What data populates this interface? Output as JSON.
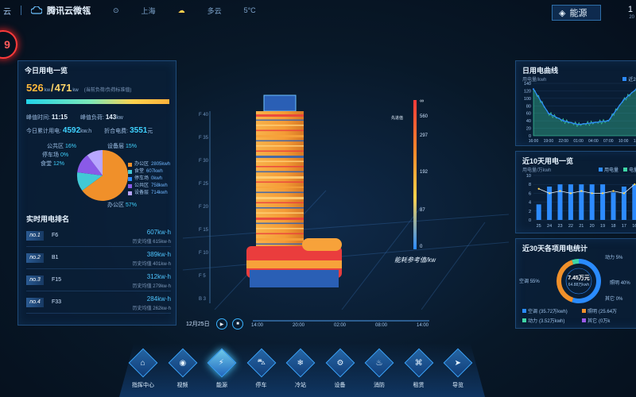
{
  "topbar": {
    "brand_prefix": "云",
    "brand_title": "腾讯云微瓴",
    "location": "上海",
    "weather": "多云",
    "temperature": "5°C",
    "section_label": "能源",
    "clock": "1",
    "clock_sub": "20"
  },
  "alert_badge": "9",
  "left_panel": {
    "title": "今日用电一览",
    "current_load": "526",
    "load_sep": "/",
    "rated_load": "471",
    "load_unit1": "kw",
    "load_unit2": "kw",
    "load_note": "(当前负荷/负荷标准值)",
    "peak_time_label": "峰值时间:",
    "peak_time": "11:15",
    "peak_load_label": "峰值负荷:",
    "peak_load": "143",
    "peak_load_unit": "kw",
    "today_total_label": "今日累计用电:",
    "today_total": "4592",
    "today_total_unit": "kw.h",
    "cost_label": "折合电费:",
    "cost": "3551",
    "cost_unit": "元",
    "pie_labels": [
      {
        "name": "公共区",
        "pct": "16%"
      },
      {
        "name": "停车场",
        "pct": "0%"
      },
      {
        "name": "食堂",
        "pct": "12%"
      },
      {
        "name": "设备层",
        "pct": "15%"
      },
      {
        "name": "办公区",
        "pct": "57%"
      }
    ],
    "legend": [
      {
        "name": "办公区",
        "value": "2805kwh",
        "color": "#f0902a"
      },
      {
        "name": "食堂",
        "value": "607kwh",
        "color": "#42c9d6"
      },
      {
        "name": "停车场",
        "value": "0kwh",
        "color": "#2d8bff"
      },
      {
        "name": "公共区",
        "value": "758kwh",
        "color": "#8a5ae8"
      },
      {
        "name": "设备层",
        "value": "714kwh",
        "color": "#b8a6ff"
      }
    ],
    "rank_title": "实时用电排名",
    "rank": [
      {
        "no": "no.1",
        "name": "F6",
        "value": "607kw·h",
        "hist": "历史均值 615kw·h"
      },
      {
        "no": "no.2",
        "name": "B1",
        "value": "389kw·h",
        "hist": "历史均值 401kw·h"
      },
      {
        "no": "no.3",
        "name": "F15",
        "value": "312kw·h",
        "hist": "历史均值 279kw·h"
      },
      {
        "no": "no.4",
        "name": "F33",
        "value": "284kw·h",
        "hist": "历史均值 262kw·h"
      }
    ]
  },
  "center": {
    "floor_labels": [
      "F 40",
      "F 35",
      "F 30",
      "F 25",
      "F 20",
      "F 15",
      "F 10",
      "F 5",
      "B 3"
    ],
    "scale_top": "∞",
    "scale_values": [
      "560",
      "297",
      "192",
      "87",
      "0"
    ],
    "scale_ref_label": "先进值",
    "scale_caption": "能耗参考值/kw",
    "colors": {
      "warm": "#f7a23a",
      "cool": "#2a5fb5",
      "red": "#ea3d3d"
    }
  },
  "timeline": {
    "date": "12月25日",
    "play_icon": "▶",
    "stop_icon": "■",
    "ticks": [
      "14:00",
      "20:00",
      "02:00",
      "08:00",
      "14:00"
    ]
  },
  "right_top": {
    "title": "日用电曲线",
    "unit": "用电量/kwh",
    "legend": "近24",
    "y_ticks": [
      "140",
      "120",
      "100",
      "80",
      "60",
      "40",
      "20",
      "0"
    ],
    "x_ticks": [
      "16:00",
      "19:00",
      "22:00",
      "01:00",
      "04:00",
      "07:00",
      "10:00",
      "13:00"
    ]
  },
  "right_mid": {
    "title": "近10天用电一览",
    "unit": "用电量/万kwh",
    "legend1": "用电量",
    "legend2": "电量",
    "y_ticks": [
      "10",
      "8",
      "6",
      "4",
      "2",
      "0"
    ],
    "x_ticks": [
      "25",
      "24",
      "23",
      "22",
      "21",
      "20",
      "19",
      "18",
      "17",
      "16"
    ]
  },
  "right_bot": {
    "title": "近30天各项用电统计",
    "center_value": "7.45万元",
    "center_sub": "64.88万kwh",
    "items": [
      {
        "name": "空调",
        "pct": "55%",
        "value": "(35.72万kwh)",
        "color": "#2a8bff"
      },
      {
        "name": "照明",
        "pct": "40%",
        "value": "(25.64万",
        "color": "#f0902a"
      },
      {
        "name": "动力",
        "pct": "5%",
        "value": "(3.52万kwh)",
        "color": "#3fd6a6"
      },
      {
        "name": "其它",
        "pct": "0%",
        "value": "(0万k",
        "color": "#9a5ae8"
      }
    ]
  },
  "nav": {
    "items": [
      {
        "label": "指挥中心",
        "icon": "⌂"
      },
      {
        "label": "视频",
        "icon": "◉"
      },
      {
        "label": "能源",
        "icon": "⚡"
      },
      {
        "label": "停车",
        "icon": "⛍"
      },
      {
        "label": "冷站",
        "icon": "❄"
      },
      {
        "label": "设备",
        "icon": "⚙"
      },
      {
        "label": "消防",
        "icon": "♨"
      },
      {
        "label": "租赁",
        "icon": "⌘"
      },
      {
        "label": "导览",
        "icon": "➤"
      }
    ],
    "active_index": 2
  },
  "chart_data": [
    {
      "type": "line",
      "title": "日用电曲线",
      "ylabel": "用电量/kwh",
      "ylim": [
        0,
        140
      ],
      "x": [
        "16:00",
        "19:00",
        "22:00",
        "01:00",
        "04:00",
        "07:00",
        "10:00",
        "13:00"
      ],
      "series": [
        {
          "name": "近24",
          "values": [
            125,
            60,
            40,
            30,
            35,
            40,
            95,
            130
          ]
        }
      ]
    },
    {
      "type": "bar",
      "title": "近10天用电一览",
      "ylabel": "用电量/万kwh",
      "ylim": [
        0,
        10
      ],
      "categories": [
        "25",
        "24",
        "23",
        "22",
        "21",
        "20",
        "19",
        "18",
        "17",
        "16"
      ],
      "series": [
        {
          "name": "用电量",
          "values": [
            3.5,
            7.5,
            8.0,
            8.0,
            8.0,
            8.0,
            8.0,
            6.2,
            7.5,
            8.0
          ]
        },
        {
          "name": "电量",
          "values": [
            7.0,
            6.0,
            6.5,
            6.0,
            6.5,
            6.0,
            6.0,
            6.5,
            6.0,
            8.0
          ]
        }
      ]
    },
    {
      "type": "pie",
      "title": "近30天各项用电统计",
      "categories": [
        "空调",
        "照明",
        "动力",
        "其它"
      ],
      "values": [
        55,
        40,
        5,
        0
      ]
    }
  ]
}
